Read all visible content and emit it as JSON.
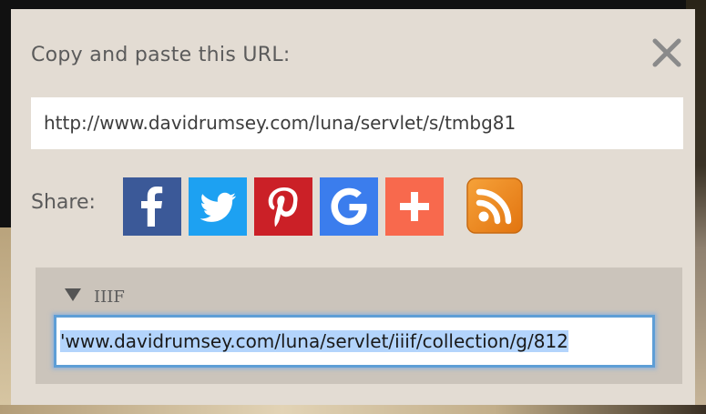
{
  "dialog": {
    "title": "Copy and paste this URL:",
    "close_icon": "close-icon",
    "url_value": "http://www.davidrumsey.com/luna/servlet/s/tmbg81"
  },
  "share": {
    "label": "Share:",
    "buttons": [
      {
        "name": "facebook",
        "icon": "facebook-icon",
        "color": "#3b5998"
      },
      {
        "name": "twitter",
        "icon": "twitter-icon",
        "color": "#1da1f2"
      },
      {
        "name": "pinterest",
        "icon": "pinterest-icon",
        "color": "#cb2027"
      },
      {
        "name": "google",
        "icon": "google-icon",
        "color": "#3b7ded"
      },
      {
        "name": "addthis",
        "icon": "plus-icon",
        "color": "#f8694d"
      },
      {
        "name": "rss",
        "icon": "rss-icon",
        "color": "#f08c1e"
      }
    ]
  },
  "iiif": {
    "label": "IIIF",
    "expanded": true,
    "url_value": "'www.davidrumsey.com/luna/servlet/iiif/collection/g/812"
  },
  "colors": {
    "dialog_bg": "#e3dcd3",
    "panel_bg": "#cbc4bb",
    "focus_ring": "#5e9ed6",
    "selection": "#b3d4fc"
  }
}
